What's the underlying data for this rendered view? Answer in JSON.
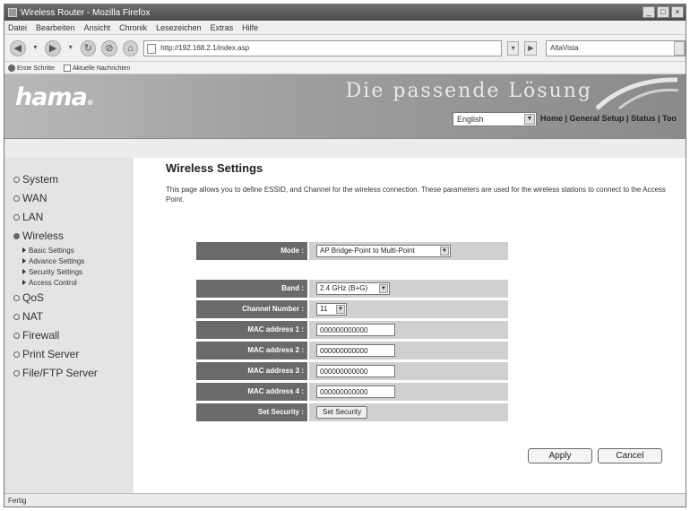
{
  "window": {
    "title": "Wireless Router - Mozilla Firefox",
    "controls": [
      "_",
      "□",
      "×"
    ]
  },
  "menu": [
    "Datei",
    "Bearbeiten",
    "Ansicht",
    "Chronik",
    "Lesezeichen",
    "Extras",
    "Hilfe"
  ],
  "navigation": {
    "url": "http://192.168.2.1/index.asp",
    "search_placeholder": "AltaVista"
  },
  "bookmarks": [
    "Erste Schritte",
    "Aktuelle Nachrichten"
  ],
  "banner": {
    "logo": "hama",
    "slogan": "Die passende Lösung",
    "language": "English",
    "links": "Home | General Setup | Status | Too"
  },
  "sidebar": {
    "items": [
      {
        "label": "System",
        "active": false
      },
      {
        "label": "WAN",
        "active": false
      },
      {
        "label": "LAN",
        "active": false
      },
      {
        "label": "Wireless",
        "active": true
      },
      {
        "label": "QoS",
        "active": false
      },
      {
        "label": "NAT",
        "active": false
      },
      {
        "label": "Firewall",
        "active": false
      },
      {
        "label": "Print Server",
        "active": false
      },
      {
        "label": "File/FTP Server",
        "active": false
      }
    ],
    "wireless_sub": [
      "Basic Settings",
      "Advance Settings",
      "Security Settings",
      "Access Control"
    ]
  },
  "page": {
    "title": "Wireless Settings",
    "description": "This page allows you to define ESSID, and Channel for the wireless connection. These parameters are used for the wireless stations to connect to the Access Point."
  },
  "form": {
    "mode": {
      "label": "Mode :",
      "value": "AP Bridge-Point to Multi-Point"
    },
    "band": {
      "label": "Band :",
      "value": "2.4 GHz (B+G)"
    },
    "channel": {
      "label": "Channel Number :",
      "value": "11"
    },
    "mac1": {
      "label": "MAC address 1 :",
      "value": "000000000000"
    },
    "mac2": {
      "label": "MAC address 2 :",
      "value": "000000000000"
    },
    "mac3": {
      "label": "MAC address 3 :",
      "value": "000000000000"
    },
    "mac4": {
      "label": "MAC address 4 :",
      "value": "000000000000"
    },
    "security": {
      "label": "Set Security :",
      "button": "Set Security"
    }
  },
  "actions": {
    "apply": "Apply",
    "cancel": "Cancel"
  },
  "status": "Fertig"
}
